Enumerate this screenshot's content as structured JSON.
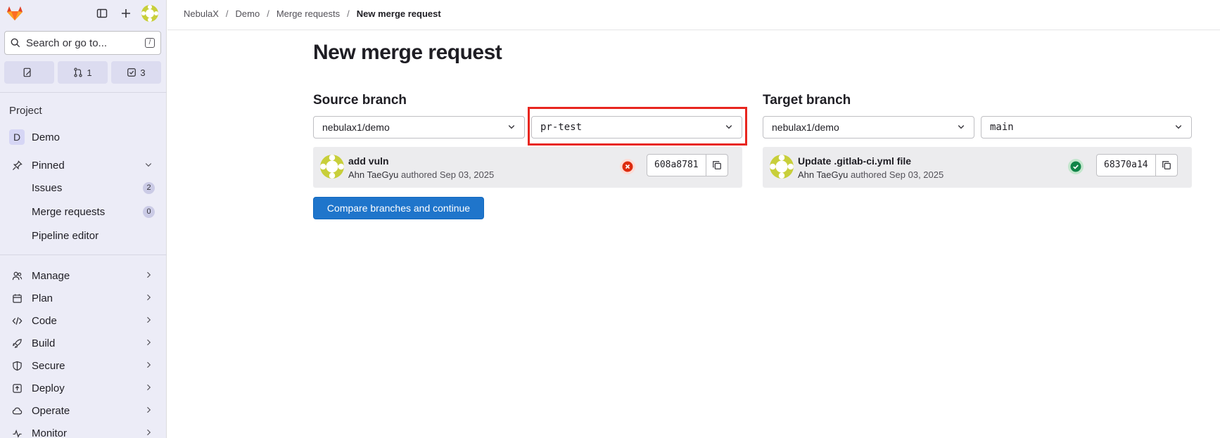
{
  "sidebar": {
    "search_placeholder": "Search or go to...",
    "search_shortcut": "/",
    "counts": {
      "issues": "",
      "merge_requests": "1",
      "todos": "3"
    },
    "section_label": "Project",
    "project_letter": "D",
    "project_name": "Demo",
    "pinned_label": "Pinned",
    "pinned_items": [
      {
        "label": "Issues",
        "badge": "2"
      },
      {
        "label": "Merge requests",
        "badge": "0"
      },
      {
        "label": "Pipeline editor",
        "badge": ""
      }
    ],
    "nav_items": [
      {
        "label": "Manage",
        "icon": "users-icon"
      },
      {
        "label": "Plan",
        "icon": "calendar-icon"
      },
      {
        "label": "Code",
        "icon": "code-icon"
      },
      {
        "label": "Build",
        "icon": "rocket-icon"
      },
      {
        "label": "Secure",
        "icon": "shield-icon"
      },
      {
        "label": "Deploy",
        "icon": "deploy-icon"
      },
      {
        "label": "Operate",
        "icon": "cloud-icon"
      },
      {
        "label": "Monitor",
        "icon": "monitor-icon"
      }
    ]
  },
  "breadcrumb": [
    "NebulaX",
    "Demo",
    "Merge requests",
    "New merge request"
  ],
  "page_title": "New merge request",
  "source": {
    "label": "Source branch",
    "project": "nebulax1/demo",
    "branch": "pr-test",
    "commit_title": "add vuln",
    "commit_author": "Ahn TaeGyu",
    "commit_authored": "authored Sep 03, 2025",
    "commit_sha": "608a8781",
    "status": "failed"
  },
  "target": {
    "label": "Target branch",
    "project": "nebulax1/demo",
    "branch": "main",
    "commit_title": "Update .gitlab-ci.yml file",
    "commit_author": "Ahn TaeGyu",
    "commit_authored": "authored Sep 03, 2025",
    "commit_sha": "68370a14",
    "status": "passed"
  },
  "compare_button": "Compare branches and continue",
  "colors": {
    "primary": "#1f75cb",
    "failed": "#dd2b0e",
    "passed": "#108548",
    "highlight": "#e8261f",
    "sidebar_bg": "#ececf7"
  }
}
